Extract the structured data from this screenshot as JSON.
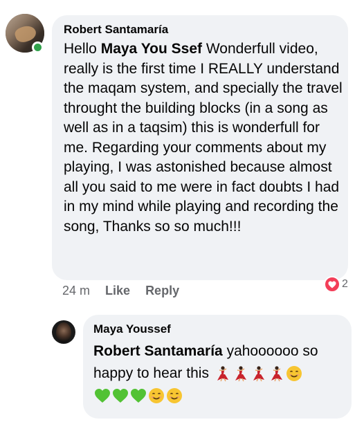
{
  "comment": {
    "author": "Robert Santamaría",
    "mention": "Maya You Ssef",
    "text_before_mention": "Hello",
    "text_after_mention": "Wonderfull video, really is the first time I REALLY understand  the maqam system, and specially the travel throught the building blocks (in a song as well as in a taqsim) this is wonderfull for me. Regarding your comments about my playing, I was astonished because almost all you said to me were in fact doubts I had in my mind while playing and recording the song, Thanks so so much!!!",
    "time": "24 m",
    "like_label": "Like",
    "reply_label": "Reply",
    "reaction_icon": "heart-icon",
    "reaction_count": "2"
  },
  "reply": {
    "author": "Maya Youssef",
    "mention": "Robert Santamaría",
    "text": "yahoooooo so happy to hear this",
    "emojis_line1": [
      "dancer-emoji",
      "dancer-emoji",
      "dancer-emoji",
      "dancer-emoji",
      "smiling-face-emoji"
    ],
    "emojis_line2": [
      "green-heart-emoji",
      "green-heart-emoji",
      "green-heart-emoji",
      "smiling-face-emoji",
      "smiling-face-emoji"
    ]
  },
  "colors": {
    "bubble_bg": "#f0f2f5",
    "meta_text": "#65676b",
    "online_green": "#31a24c",
    "heart_red": "#f33e58",
    "green_heart": "#52c234",
    "smile_yellow": "#f7c531",
    "dancer_red": "#c8232c"
  }
}
